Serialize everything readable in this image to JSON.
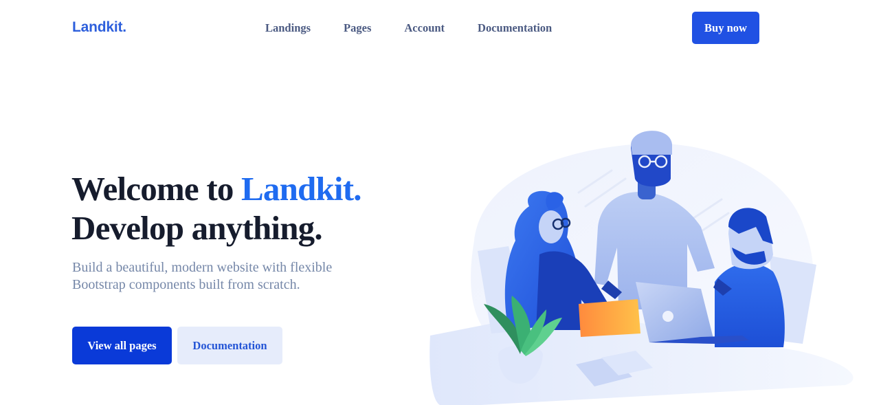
{
  "brand": {
    "logo_text": "Landkit."
  },
  "nav": {
    "links": [
      "Landings",
      "Pages",
      "Account",
      "Documentation"
    ],
    "buy_label": "Buy now"
  },
  "hero": {
    "title_line1_prefix": "Welcome to ",
    "title_line1_accent": "Landkit.",
    "title_line2": "Develop anything.",
    "subtitle": "Build a beautiful, modern website with flexible Bootstrap components built from scratch.",
    "primary_button": "View all pages",
    "secondary_button": "Documentation"
  },
  "colors": {
    "primary": "#0a3ad8",
    "accent": "#1f6bf0",
    "soft_button_bg": "#e6ecfb",
    "nav_text": "#4b5a82",
    "muted_text": "#7587a8"
  },
  "illustration": {
    "icon": "team-collaboration-illustration"
  }
}
